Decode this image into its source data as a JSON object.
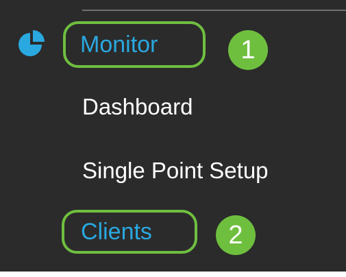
{
  "nav": {
    "section": {
      "label": "Monitor",
      "icon": "pie-chart-icon"
    },
    "items": [
      {
        "label": "Dashboard"
      },
      {
        "label": "Single Point Setup"
      },
      {
        "label": "Clients"
      }
    ]
  },
  "annotations": {
    "step_1": "1",
    "step_2": "2"
  },
  "colors": {
    "panel_background": "#2b2b2b",
    "active_text": "#2aa8e0",
    "item_text": "#ffffff",
    "annotation_green": "#6fbf3f"
  }
}
